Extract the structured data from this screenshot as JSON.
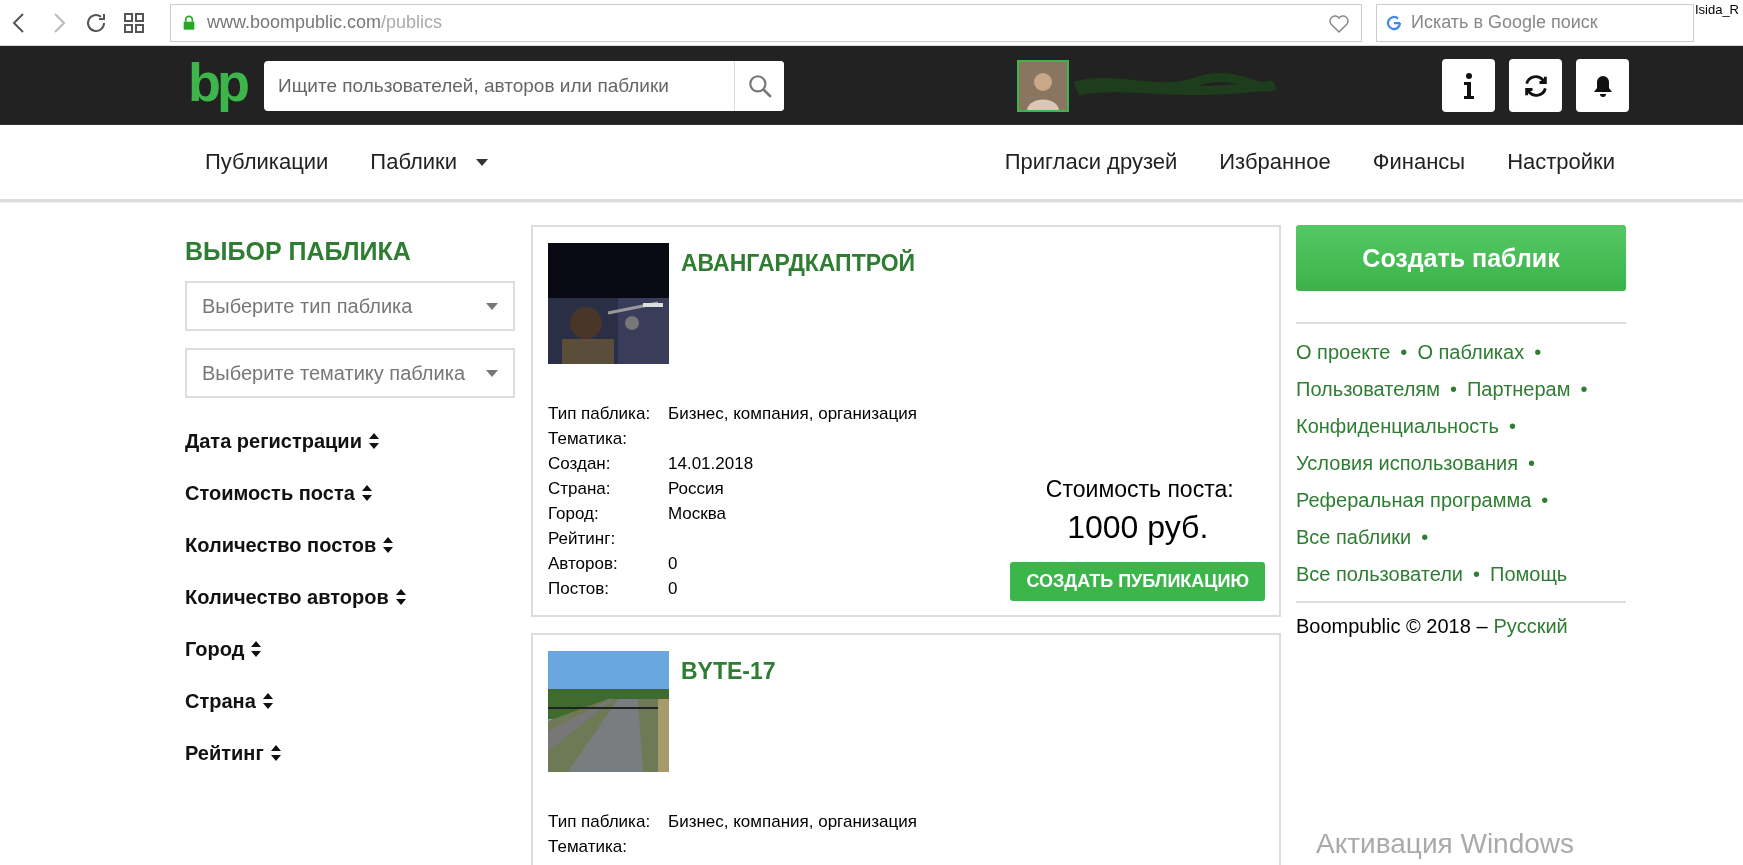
{
  "browser": {
    "url_host": "www.boompublic.com",
    "url_path": "/publics",
    "secure": true,
    "search_placeholder": "Искать в Google поиск",
    "user": "Isida_R"
  },
  "header": {
    "logo": "bp",
    "search_placeholder": "Ищите пользователей, авторов или паблики"
  },
  "nav": {
    "left": [
      {
        "label": "Публикации",
        "dropdown": false
      },
      {
        "label": "Паблики",
        "dropdown": true
      }
    ],
    "right": [
      {
        "label": "Пригласи друзей"
      },
      {
        "label": "Избранное"
      },
      {
        "label": "Финансы"
      },
      {
        "label": "Настройки"
      }
    ]
  },
  "sidebar": {
    "title": "ВЫБОР ПАБЛИКА",
    "selects": [
      {
        "placeholder": "Выберите тип паблика"
      },
      {
        "placeholder": "Выберите тематику паблика"
      }
    ],
    "sorts": [
      {
        "label": "Дата регистрации"
      },
      {
        "label": "Стоимость поста"
      },
      {
        "label": "Количество постов"
      },
      {
        "label": "Количество авторов"
      },
      {
        "label": "Город"
      },
      {
        "label": "Страна"
      },
      {
        "label": "Рейтинг"
      }
    ]
  },
  "publics": [
    {
      "name": "АВАНГАРДКАПТРОЙ",
      "details": [
        {
          "label": "Тип паблика:",
          "value": "Бизнес, компания, организация"
        },
        {
          "label": "Тематика:"
        },
        {
          "label": "Создан:",
          "value": "14.01.2018"
        },
        {
          "label": "Страна:",
          "value": "Россия"
        },
        {
          "label": "Город:",
          "value": "Москва"
        },
        {
          "label": "Рейтинг:"
        },
        {
          "label": "Авторов:",
          "value": "0"
        },
        {
          "label": "Постов:",
          "value": "0"
        }
      ],
      "price_label": "Стоимость поста:",
      "price": "1000 руб.",
      "button": "СОЗДАТЬ ПУБЛИКАЦИЮ"
    },
    {
      "name": "BYTE-17",
      "details": [
        {
          "label": "Тип паблика:",
          "value": "Бизнес, компания, организация"
        },
        {
          "label": "Тематика:"
        }
      ]
    }
  ],
  "aside": {
    "create_button": "Создать паблик",
    "link_lines": [
      [
        {
          "label": "О проекте",
          "bullet": "•"
        },
        {
          "label": "О пабликах",
          "bullet": "•"
        }
      ],
      [
        {
          "label": "Пользователям",
          "bullet": "•"
        },
        {
          "label": "Партнерам",
          "bullet": "•"
        }
      ],
      [
        {
          "label": "Конфиденциальность",
          "bullet": "•"
        }
      ],
      [
        {
          "label": "Условия использования",
          "bullet": "•"
        }
      ],
      [
        {
          "label": "Реферальная программа",
          "bullet": "•"
        }
      ],
      [
        {
          "label": "Все паблики",
          "bullet": "•"
        }
      ],
      [
        {
          "label": "Все пользователи",
          "bullet": "•"
        },
        {
          "label": "Помощь"
        }
      ]
    ],
    "copyright": "Boompublic © 2018 –",
    "language": "Русский"
  },
  "os_notice": "Активация Windows"
}
